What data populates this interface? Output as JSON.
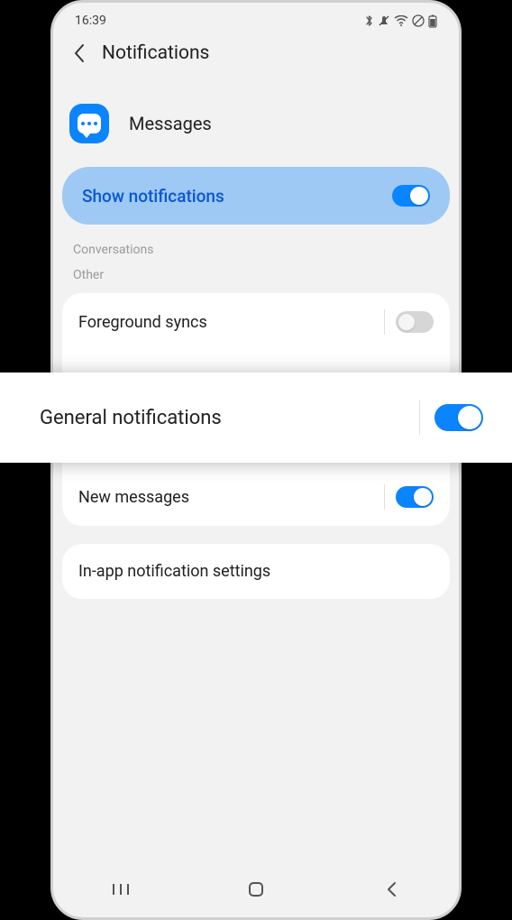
{
  "status": {
    "time": "16:39"
  },
  "header": {
    "title": "Notifications"
  },
  "app": {
    "name": "Messages"
  },
  "main_toggle": {
    "label": "Show notifications",
    "on": true
  },
  "sections": {
    "conversations": "Conversations",
    "other": "Other"
  },
  "rows": {
    "foreground": {
      "label": "Foreground syncs",
      "on": false
    },
    "general": {
      "label": "General notifications",
      "on": true
    },
    "new_messages": {
      "label": "New messages",
      "on": true
    },
    "in_app": {
      "label": "In-app notification settings"
    }
  }
}
